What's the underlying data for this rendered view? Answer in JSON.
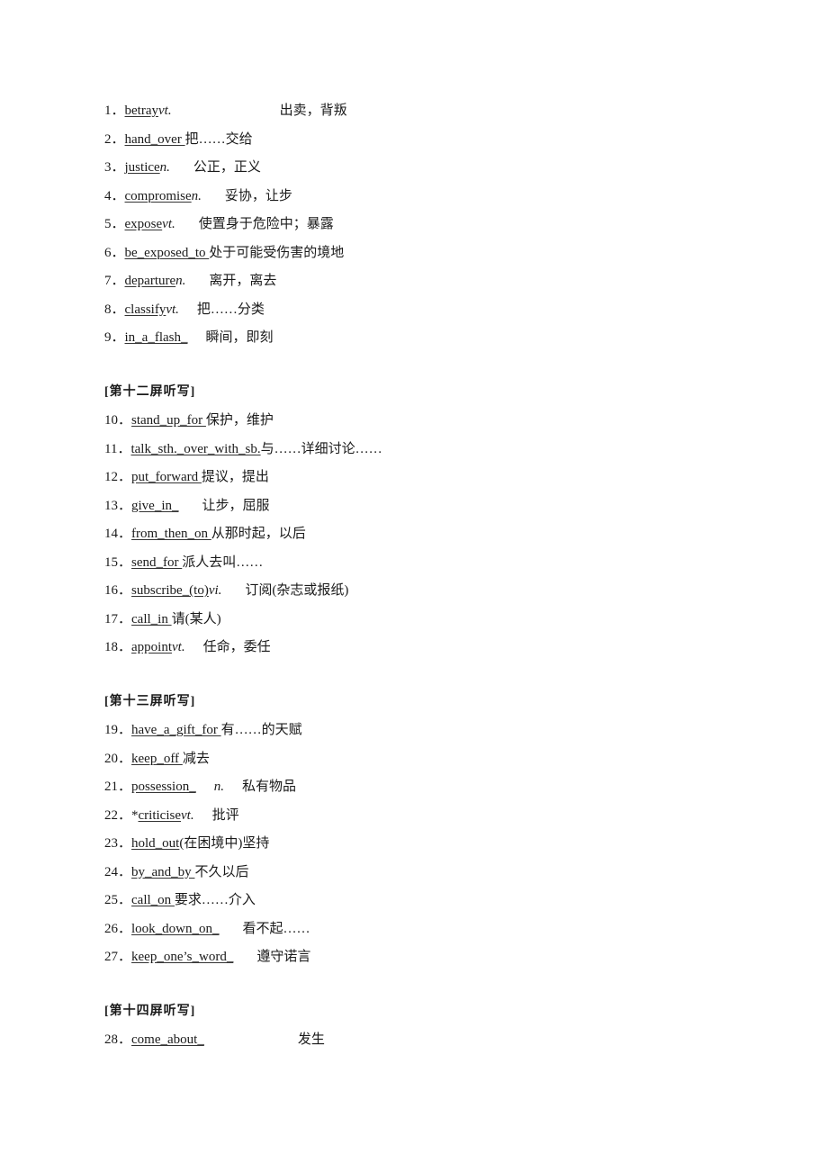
{
  "sections": [
    {
      "heading": "",
      "items": [
        {
          "num": "1．",
          "term": "betray",
          "pos": "vt.",
          "meaning": "出卖，背叛",
          "gap": "lg"
        },
        {
          "num": "2．",
          "term": "hand_over ",
          "pos": "",
          "meaning": "把……交给",
          "gap": ""
        },
        {
          "num": "3．",
          "term": "justice",
          "pos": "n.",
          "meaning": "公正，正义",
          "gap": "md"
        },
        {
          "num": "4．",
          "term": "compromise",
          "pos": "n.",
          "meaning": "妥协，让步",
          "gap": "md"
        },
        {
          "num": "5．",
          "term": "expose",
          "pos": "vt.",
          "meaning": "使置身于危险中；暴露",
          "gap": "md"
        },
        {
          "num": "6．",
          "term": "be_exposed_to ",
          "pos": "",
          "meaning": "处于可能受伤害的境地",
          "gap": ""
        },
        {
          "num": "7．",
          "term": "departure",
          "pos": "n.",
          "meaning": "离开，离去",
          "gap": "md"
        },
        {
          "num": "8．",
          "term": "classify",
          "pos": "vt.",
          "meaning": "把……分类",
          "gap": "sm"
        },
        {
          "num": "9．",
          "term": "in_a_flash_",
          "pos": "",
          "meaning": "瞬间，即刻",
          "gap": "sm"
        }
      ]
    },
    {
      "heading": "[第十二屏听写]",
      "items": [
        {
          "num": "10．",
          "term": "stand_up_for ",
          "pos": "",
          "meaning": "保护，维护",
          "gap": ""
        },
        {
          "num": "11．",
          "term": "talk_sth._over_with_sb.",
          "pos": "",
          "meaning": "与……详细讨论……",
          "gap": ""
        },
        {
          "num": "12．",
          "term": "put_forward ",
          "pos": "",
          "meaning": "提议，提出",
          "gap": ""
        },
        {
          "num": "13．",
          "term": "give_in_",
          "pos": "",
          "meaning": "让步，屈服",
          "gap": "md"
        },
        {
          "num": "14．",
          "term": "from_then_on ",
          "pos": "",
          "meaning": "从那时起，以后",
          "gap": ""
        },
        {
          "num": "15．",
          "term": "send_for ",
          "pos": "",
          "meaning": "派人去叫……",
          "gap": ""
        },
        {
          "num": "16．",
          "term": "subscribe_(to)",
          "pos": "vi.",
          "meaning": "订阅(杂志或报纸)",
          "gap": "md"
        },
        {
          "num": "17．",
          "term": "call_in ",
          "pos": "",
          "meaning": "请(某人)",
          "gap": ""
        },
        {
          "num": "18．",
          "term": "appoint",
          "pos": "vt.",
          "meaning": "任命，委任",
          "gap": "sm"
        }
      ]
    },
    {
      "heading": "[第十三屏听写]",
      "items": [
        {
          "num": "19．",
          "term": "have_a_gift_for ",
          "pos": "",
          "meaning": "有……的天赋",
          "gap": ""
        },
        {
          "num": "20．",
          "term": "keep_off ",
          "pos": "",
          "meaning": "减去",
          "gap": ""
        },
        {
          "num": "21．",
          "prefix": "",
          "term": "possession_",
          "pos_pre": "n.",
          "pos": "",
          "meaning": "私有物品",
          "gap": "sm"
        },
        {
          "num": "22．",
          "prefix": "*",
          "term": "criticise",
          "pos": "vt.",
          "meaning": "批评",
          "gap": "sm"
        },
        {
          "num": "23．",
          "term": "hold_out",
          "pos": "",
          "meaning": "(在困境中)坚持",
          "gap": ""
        },
        {
          "num": "24．",
          "term": "by_and_by ",
          "pos": "",
          "meaning": "不久以后",
          "gap": ""
        },
        {
          "num": "25．",
          "term": "call_on ",
          "pos": "",
          "meaning": "要求……介入",
          "gap": ""
        },
        {
          "num": "26．",
          "term": "look_down_on_",
          "pos": "",
          "meaning": "看不起……",
          "gap": "md"
        },
        {
          "num": "27．",
          "term": "keep_one’s_word_",
          "pos": "",
          "meaning": "遵守诺言",
          "gap": "md"
        }
      ]
    },
    {
      "heading": "[第十四屏听写]",
      "items": [
        {
          "num": "28．",
          "term": "come_about_",
          "pos": "",
          "meaning": "发生",
          "gap": "xl"
        }
      ]
    }
  ]
}
